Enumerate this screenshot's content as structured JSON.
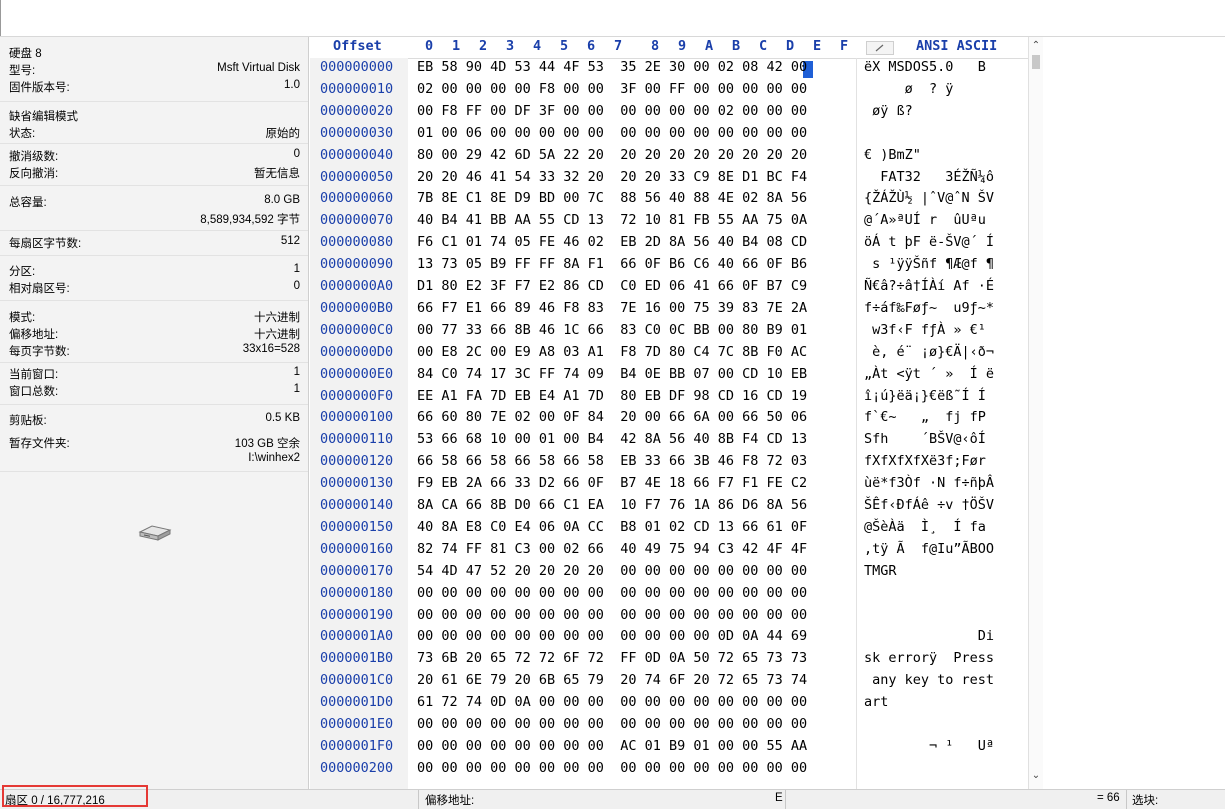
{
  "info_panel": {
    "disk_name": "硬盘 8",
    "model_label": "型号:",
    "model_value": "Msft Virtual Disk",
    "firmware_label": "固件版本号:",
    "firmware_value": "1.0",
    "default_edit_mode_label": "缺省编辑模式",
    "state_label": "状态:",
    "state_value": "原始的",
    "undo_level_label": "撤消级数:",
    "undo_level_value": "0",
    "reverse_undo_label": "反向撤消:",
    "reverse_undo_value": "暂无信息",
    "total_capacity_label": "总容量:",
    "total_capacity_value": "8.0 GB",
    "total_bytes_value": "8,589,934,592 字节",
    "bytes_per_sector_label": "每扇区字节数:",
    "bytes_per_sector_value": "512",
    "partition_label": "分区:",
    "partition_value": "1",
    "relative_sector_label": "相对扇区号:",
    "relative_sector_value": "0",
    "mode_label": "模式:",
    "mode_value": "十六进制",
    "offset_label": "偏移地址:",
    "offset_value": "十六进制",
    "bytes_per_page_label": "每页字节数:",
    "bytes_per_page_value": "33x16=528",
    "current_window_label": "当前窗口:",
    "current_window_value": "1",
    "window_total_label": "窗口总数:",
    "window_total_value": "1",
    "clipboard_label": "剪贴板:",
    "clipboard_value": "0.5 KB",
    "temp_folder_label": "暂存文件夹:",
    "temp_folder_value": "103 GB 空余",
    "temp_folder_path": "I:\\winhex2",
    "disk_icon": "hard-disk-icon"
  },
  "hex_view": {
    "offset_header": "Offset",
    "columns": [
      "0",
      "1",
      "2",
      "3",
      "4",
      "5",
      "6",
      "7",
      "8",
      "9",
      "A",
      "B",
      "C",
      "D",
      "E",
      "F"
    ],
    "charset_header": "ANSI ASCII",
    "selected_byte": "42",
    "rows": [
      {
        "offset": "000000000",
        "hex": "EB 58 90 4D 53 44 4F 53  35 2E 30 00 02 08 42 00",
        "ascii": "ëX MSDOS5.0   B "
      },
      {
        "offset": "000000010",
        "hex": "02 00 00 00 00 F8 00 00  3F 00 FF 00 00 00 00 00",
        "ascii": "     ø  ? ÿ     "
      },
      {
        "offset": "000000020",
        "hex": "00 F8 FF 00 DF 3F 00 00  00 00 00 00 02 00 00 00",
        "ascii": " øÿ ß?          "
      },
      {
        "offset": "000000030",
        "hex": "01 00 06 00 00 00 00 00  00 00 00 00 00 00 00 00",
        "ascii": "                "
      },
      {
        "offset": "000000040",
        "hex": "80 00 29 42 6D 5A 22 20  20 20 20 20 20 20 20 20",
        "ascii": "€ )BmZ\"         "
      },
      {
        "offset": "000000050",
        "hex": "20 20 46 41 54 33 32 20  20 20 33 C9 8E D1 BC F4",
        "ascii": "  FAT32   3ÉŽÑ¼ô"
      },
      {
        "offset": "000000060",
        "hex": "7B 8E C1 8E D9 BD 00 7C  88 56 40 88 4E 02 8A 56",
        "ascii": "{ŽÁŽÙ½ |ˆV@ˆN ŠV"
      },
      {
        "offset": "000000070",
        "hex": "40 B4 41 BB AA 55 CD 13  72 10 81 FB 55 AA 75 0A",
        "ascii": "@´A»ªUÍ r  ûUªu "
      },
      {
        "offset": "000000080",
        "hex": "F6 C1 01 74 05 FE 46 02  EB 2D 8A 56 40 B4 08 CD",
        "ascii": "öÁ t þF ë-ŠV@´ Í"
      },
      {
        "offset": "000000090",
        "hex": "13 73 05 B9 FF FF 8A F1  66 0F B6 C6 40 66 0F B6",
        "ascii": " s ¹ÿÿŠñf ¶Æ@f ¶"
      },
      {
        "offset": "0000000A0",
        "hex": "D1 80 E2 3F F7 E2 86 CD  C0 ED 06 41 66 0F B7 C9",
        "ascii": "Ñ€â?÷â†ÍÀí Af ·É"
      },
      {
        "offset": "0000000B0",
        "hex": "66 F7 E1 66 89 46 F8 83  7E 16 00 75 39 83 7E 2A",
        "ascii": "f÷áf‰Føƒ~  u9ƒ~*"
      },
      {
        "offset": "0000000C0",
        "hex": "00 77 33 66 8B 46 1C 66  83 C0 0C BB 00 80 B9 01",
        "ascii": " w3f‹F fƒÀ » €¹ "
      },
      {
        "offset": "0000000D0",
        "hex": "00 E8 2C 00 E9 A8 03 A1  F8 7D 80 C4 7C 8B F0 AC",
        "ascii": " è, é¨ ¡ø}€Ä|‹ð¬"
      },
      {
        "offset": "0000000E0",
        "hex": "84 C0 74 17 3C FF 74 09  B4 0E BB 07 00 CD 10 EB",
        "ascii": "„Àt <ÿt ´ »  Í ë"
      },
      {
        "offset": "0000000F0",
        "hex": "EE A1 FA 7D EB E4 A1 7D  80 EB DF 98 CD 16 CD 19",
        "ascii": "î¡ú}ëä¡}€ëß˜Í Í "
      },
      {
        "offset": "000000100",
        "hex": "66 60 80 7E 02 00 0F 84  20 00 66 6A 00 66 50 06",
        "ascii": "f`€~   „  fj fP "
      },
      {
        "offset": "000000110",
        "hex": "53 66 68 10 00 01 00 B4  42 8A 56 40 8B F4 CD 13",
        "ascii": "Sfh    ´BŠV@‹ôÍ "
      },
      {
        "offset": "000000120",
        "hex": "66 58 66 58 66 58 66 58  EB 33 66 3B 46 F8 72 03",
        "ascii": "fXfXfXfXë3f;Før "
      },
      {
        "offset": "000000130",
        "hex": "F9 EB 2A 66 33 D2 66 0F  B7 4E 18 66 F7 F1 FE C2",
        "ascii": "ùë*f3Òf ·N f÷ñþÂ"
      },
      {
        "offset": "000000140",
        "hex": "8A CA 66 8B D0 66 C1 EA  10 F7 76 1A 86 D6 8A 56",
        "ascii": "ŠÊf‹ÐfÁê ÷v †ÖŠV"
      },
      {
        "offset": "000000150",
        "hex": "40 8A E8 C0 E4 06 0A CC  B8 01 02 CD 13 66 61 0F",
        "ascii": "@ŠèÀä  Ì¸  Í fa "
      },
      {
        "offset": "000000160",
        "hex": "82 74 FF 81 C3 00 02 66  40 49 75 94 C3 42 4F 4F",
        "ascii": "‚tÿ Ã  f@Iu”ÃBOO"
      },
      {
        "offset": "000000170",
        "hex": "54 4D 47 52 20 20 20 20  00 00 00 00 00 00 00 00",
        "ascii": "TMGR            "
      },
      {
        "offset": "000000180",
        "hex": "00 00 00 00 00 00 00 00  00 00 00 00 00 00 00 00",
        "ascii": "                "
      },
      {
        "offset": "000000190",
        "hex": "00 00 00 00 00 00 00 00  00 00 00 00 00 00 00 00",
        "ascii": "                "
      },
      {
        "offset": "0000001A0",
        "hex": "00 00 00 00 00 00 00 00  00 00 00 00 0D 0A 44 69",
        "ascii": "              Di"
      },
      {
        "offset": "0000001B0",
        "hex": "73 6B 20 65 72 72 6F 72  FF 0D 0A 50 72 65 73 73",
        "ascii": "sk errorÿ  Press"
      },
      {
        "offset": "0000001C0",
        "hex": "20 61 6E 79 20 6B 65 79  20 74 6F 20 72 65 73 74",
        "ascii": " any key to rest"
      },
      {
        "offset": "0000001D0",
        "hex": "61 72 74 0D 0A 00 00 00  00 00 00 00 00 00 00 00",
        "ascii": "art             "
      },
      {
        "offset": "0000001E0",
        "hex": "00 00 00 00 00 00 00 00  00 00 00 00 00 00 00 00",
        "ascii": "                "
      },
      {
        "offset": "0000001F0",
        "hex": "00 00 00 00 00 00 00 00  AC 01 B9 01 00 00 55 AA",
        "ascii": "        ¬ ¹   Uª"
      },
      {
        "offset": "000000200",
        "hex": "00 00 00 00 00 00 00 00  00 00 00 00 00 00 00 00",
        "ascii": "                "
      }
    ]
  },
  "status_bar": {
    "sector": "扇区 0 / 16,777,216",
    "offset_label": "偏移地址:",
    "offset_value": "E",
    "value": "= 66",
    "selection_label": "选块:"
  },
  "colors": {
    "accent": "#1a3faa",
    "selection": "#1f5fd6",
    "highlight_box": "#e53935"
  }
}
